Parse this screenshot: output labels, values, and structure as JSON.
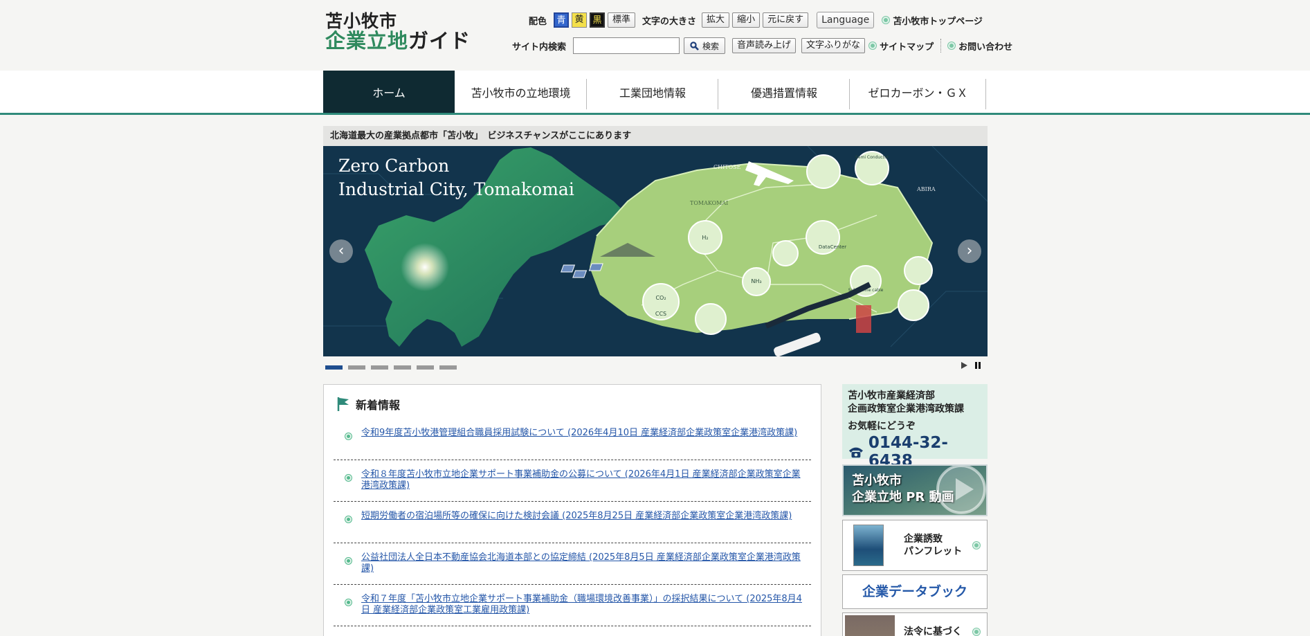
{
  "header": {
    "logo_line1": "苫小牧市",
    "logo_line2_green": "企業立地",
    "logo_line2_dark": "ガイド",
    "color_label": "配色",
    "color_buttons": [
      "青",
      "黄",
      "黒",
      "標準"
    ],
    "font_size_label": "文字の大きさ",
    "font_buttons": [
      "拡大",
      "縮小",
      "元に戻す"
    ],
    "language_label": "Language",
    "top_page_link": "苫小牧市トップページ",
    "search_label": "サイト内検索",
    "search_placeholder": "",
    "search_button": "検索",
    "speech_button": "音声読み上げ",
    "furigana_button": "文字ふりがな",
    "sitemap_link": "サイトマップ",
    "contact_link": "お問い合わせ"
  },
  "nav": {
    "items": [
      "ホーム",
      "苫小牧市の立地環境",
      "工業団地情報",
      "優遇措置情報",
      "ゼロカーボン・ＧＸ"
    ]
  },
  "slider": {
    "tagline": "北海道最大の産業拠点都市「苫小牧」　ビジネスチャンスがここにあります",
    "title_line1": "Zero Carbon",
    "title_line2": "Industrial City, Tomakomai",
    "map_labels": {
      "chitose": "CHITOSE",
      "tomakomai": "TOMAKOMAI",
      "abira": "ABIRA",
      "datacenter": "DataCenter",
      "semiconductor": "Semi Conductor",
      "submarine": "Submarine cable",
      "ccs": "CCS"
    },
    "slide_count": 6,
    "active_slide": 1
  },
  "news": {
    "heading": "新着情報",
    "items": [
      "令和9年度苫小牧港管理組合職員採用試験について (2026年4月10日 産業経済部企業政策室企業港湾政策課)",
      "令和８年度苫小牧市立地企業サポート事業補助金の公募について (2026年4月1日 産業経済部企業政策室企業港湾政策課)",
      "短期労働者の宿泊場所等の確保に向けた検討会議 (2025年8月25日 産業経済部企業政策室企業港湾政策課)",
      "公益社団法人全日本不動産協会北海道本部との協定締結 (2025年8月5日 産業経済部企業政策室企業港湾政策課)",
      "令和７年度「苫小牧市立地企業サポート事業補助金（職場環境改善事業）」の採択結果について (2025年8月4日 産業経済部企業政策室工業雇用政策課)"
    ]
  },
  "sidebar": {
    "contact_dept_line1": "苫小牧市産業経済部",
    "contact_dept_line2": "企画政策室企業港湾政策課",
    "contact_invite": "お気軽にどうぞ",
    "contact_phone": "0144-32-6438",
    "pr_video_line1": "苫小牧市",
    "pr_video_line2": "企業立地 PR 動画",
    "pamphlet_line1": "企業誘致",
    "pamphlet_line2": "パンフレット",
    "databook": "企業データブック",
    "law_text": "法令に基づく"
  },
  "colors": {
    "accent_green": "#2f8a5e",
    "nav_active": "#0f2a32",
    "nav_border": "#2f8a7a",
    "link_blue": "#2456a8",
    "slider_bg": "#13324a"
  }
}
